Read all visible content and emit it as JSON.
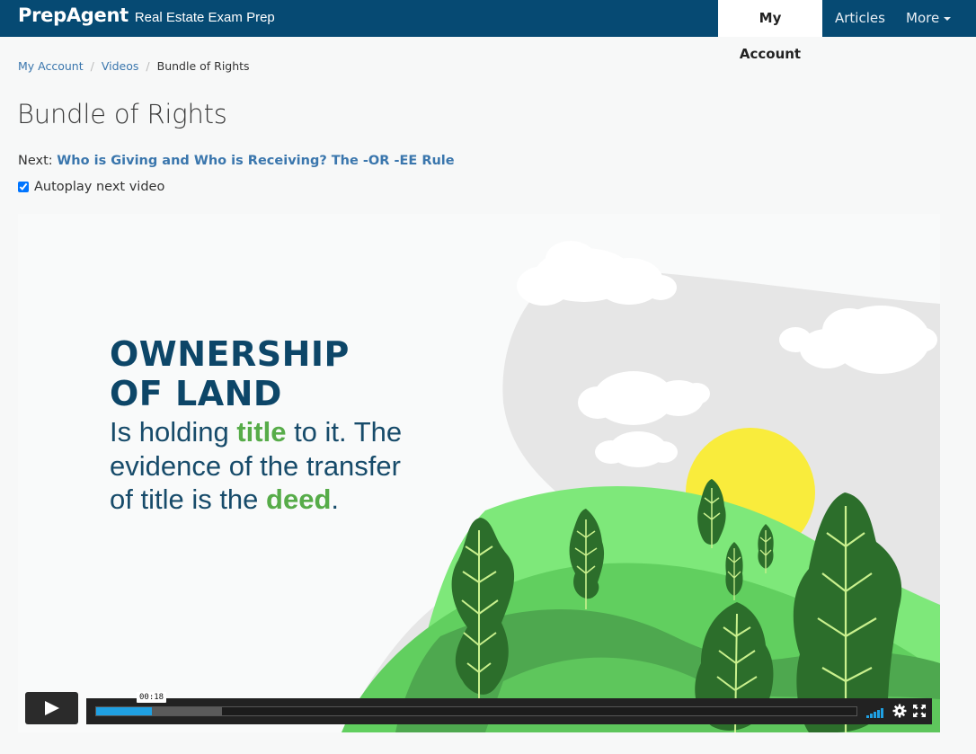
{
  "navbar": {
    "brand_name": "PrepAgent",
    "brand_subtitle": "Real Estate Exam Prep",
    "items": [
      {
        "label": "My Account",
        "active": true
      },
      {
        "label": "Articles",
        "active": false
      },
      {
        "label": "More",
        "active": false
      }
    ]
  },
  "breadcrumb": [
    "My Account",
    "Videos",
    "Bundle of Rights"
  ],
  "page": {
    "title": "Bundle of Rights",
    "next_prefix": "Next:",
    "next_title": "Who is Giving and Who is Receiving? The -OR -EE Rule",
    "autoplay_label": "Autoplay next video",
    "autoplay_checked": true
  },
  "slide": {
    "heading_line1": "OWNERSHIP",
    "heading_line2": "OF LAND",
    "body_part1": "Is holding ",
    "body_title_word": "title",
    "body_part2": " to it. The evidence of the transfer of title is the ",
    "body_deed_word": "deed",
    "body_end": "."
  },
  "player": {
    "time_label": "00:18",
    "played_fraction": 0.073,
    "buffered_fraction": 0.165,
    "accent_color": "#1fa0e2",
    "icons": [
      "play-icon",
      "volume-icon",
      "settings-gear-icon",
      "fullscreen-icon"
    ]
  }
}
